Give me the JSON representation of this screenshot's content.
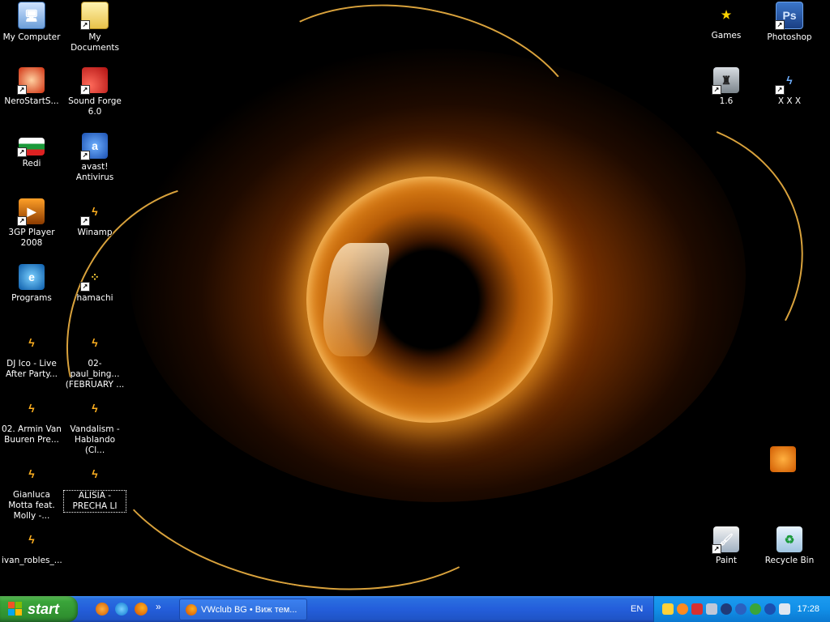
{
  "desktop": {
    "icons": [
      {
        "label": "My Computer",
        "icon": "computer-icon"
      },
      {
        "label": "My Documents",
        "icon": "documents-folder-icon"
      },
      {
        "label": "NeroStartS...",
        "icon": "nero-icon"
      },
      {
        "label": "Sound Forge 6.0",
        "icon": "sound-forge-icon"
      },
      {
        "label": "Redi",
        "icon": "flag-icon"
      },
      {
        "label": "avast! Antivirus",
        "icon": "avast-icon"
      },
      {
        "label": "3GP Player 2008",
        "icon": "3gp-player-icon"
      },
      {
        "label": "Winamp",
        "icon": "winamp-icon"
      },
      {
        "label": "Programs",
        "icon": "internet-explorer-icon"
      },
      {
        "label": "hamachi",
        "icon": "hamachi-icon"
      },
      {
        "label": "DJ Ico - Live After Party...",
        "icon": "winamp-file-icon"
      },
      {
        "label": "02-paul_bing... (FEBRUARY ...",
        "icon": "winamp-file-icon"
      },
      {
        "label": "02. Armin Van Buuren Pre...",
        "icon": "winamp-file-icon"
      },
      {
        "label": "Vandalism - Hablando (Cl...",
        "icon": "winamp-file-icon"
      },
      {
        "label": "Gianluca Motta feat. Molly -...",
        "icon": "winamp-file-icon"
      },
      {
        "label": "ALISIA - PRECHA LI",
        "icon": "winamp-file-icon"
      },
      {
        "label": "ivan_robles_...",
        "icon": "winamp-file-icon"
      },
      {
        "label": "Games",
        "icon": "star-icon"
      },
      {
        "label": "Photoshop",
        "icon": "photoshop-icon"
      },
      {
        "label": "1.6",
        "icon": "counter-strike-icon"
      },
      {
        "label": "X X X",
        "icon": "xxx-icon"
      },
      {
        "label": "",
        "icon": "vlc-icon"
      },
      {
        "label": "Paint",
        "icon": "paint-icon"
      },
      {
        "label": "Recycle Bin",
        "icon": "recycle-bin-icon"
      }
    ]
  },
  "taskbar": {
    "start_label": "start",
    "task_item_label": "VWclub BG • Виж тем...",
    "language": "EN",
    "clock": "17:28",
    "quick_launch_overflow": "»"
  },
  "colors": {
    "taskbar_blue": "#245edb",
    "start_green": "#3aa53a",
    "tray_blue": "#1290e8"
  }
}
